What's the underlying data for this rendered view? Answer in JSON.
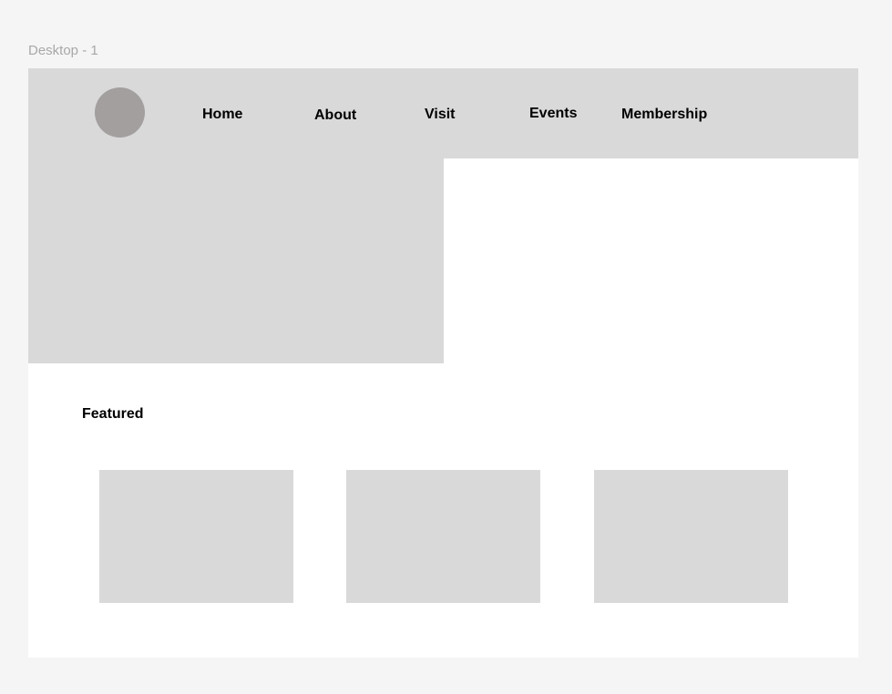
{
  "frame": {
    "label": "Desktop - 1"
  },
  "nav": {
    "items": [
      {
        "label": "Home"
      },
      {
        "label": "About"
      },
      {
        "label": "Visit"
      },
      {
        "label": "Events"
      },
      {
        "label": "Membership"
      }
    ]
  },
  "featured": {
    "title": "Featured",
    "cards": 3
  },
  "colors": {
    "canvas": "#f5f5f5",
    "frame": "#ffffff",
    "placeholder": "#d9d9d9",
    "logo": "#a39f9f",
    "label": "#a8a8a8",
    "text": "#000000"
  }
}
